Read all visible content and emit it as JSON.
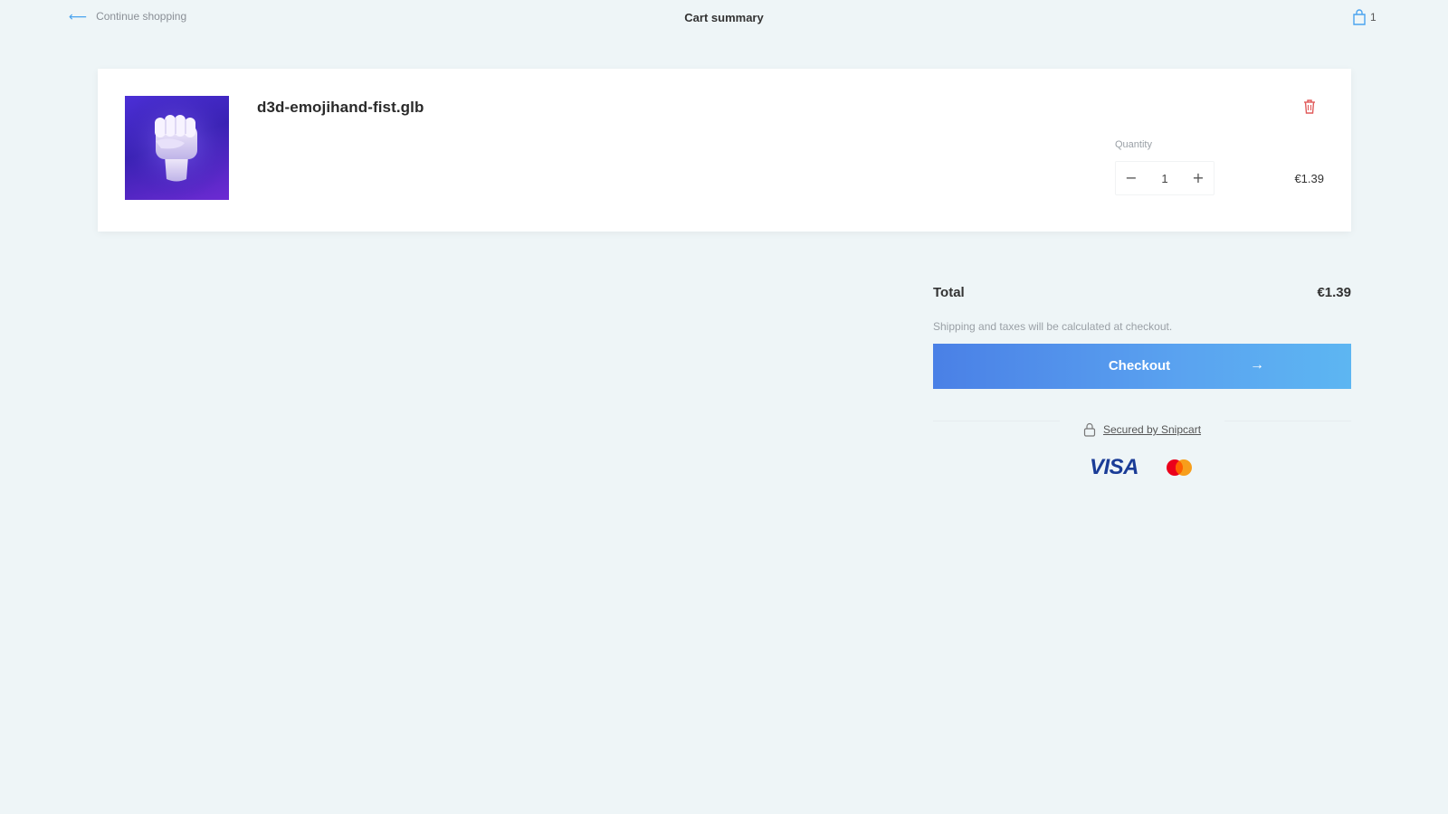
{
  "header": {
    "continue_label": "Continue shopping",
    "title": "Cart summary",
    "cart_count": "1"
  },
  "cart": {
    "items": [
      {
        "name": "d3d-emojihand-fist.glb",
        "quantity_label": "Quantity",
        "quantity": "1",
        "price": "€1.39",
        "image_icon": "raised-fist-icon"
      }
    ]
  },
  "summary": {
    "total_label": "Total",
    "total_value": "€1.39",
    "shipping_note": "Shipping and taxes will be calculated at checkout.",
    "checkout_label": "Checkout",
    "secured_label": "Secured by Snipcart"
  },
  "payment_methods": {
    "visa_label": "VISA",
    "mastercard_icon": "mastercard-icon"
  },
  "colors": {
    "background": "#eef5f7",
    "accent": "#4aa3ef",
    "checkout_gradient_start": "#4a80e6",
    "checkout_gradient_end": "#5db6f2",
    "delete": "#e05a5a"
  }
}
